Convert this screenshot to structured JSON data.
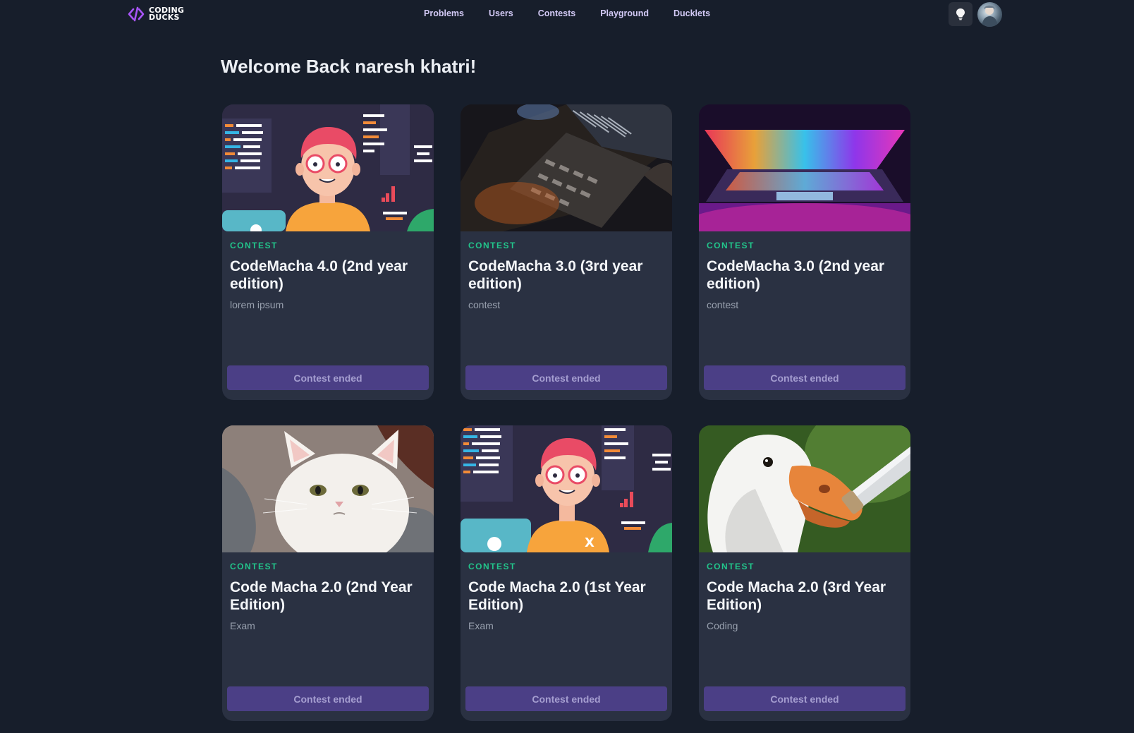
{
  "brand": {
    "line1": "CODING",
    "line2": "DUCKS",
    "accent": "#a855f7"
  },
  "nav": {
    "links": [
      "Problems",
      "Users",
      "Contests",
      "Playground",
      "Ducklets"
    ]
  },
  "icons": {
    "theme": "lightbulb-icon",
    "avatar": "user-avatar"
  },
  "welcome": "Welcome Back naresh khatri!",
  "cards": [
    {
      "tag": "CONTEST",
      "title": "CodeMacha 4.0 (2nd year edition)",
      "desc": "lorem ipsum",
      "button": "Contest ended",
      "image": "coder-illustration"
    },
    {
      "tag": "CONTEST",
      "title": "CodeMacha 3.0 (3rd year edition)",
      "desc": "contest",
      "button": "Contest ended",
      "image": "laptop-code-photo"
    },
    {
      "tag": "CONTEST",
      "title": "CodeMacha 3.0 (2nd year edition)",
      "desc": "contest",
      "button": "Contest ended",
      "image": "rainbow-laptop-photo"
    },
    {
      "tag": "CONTEST",
      "title": "Code Macha 2.0 (2nd Year Edition)",
      "desc": "Exam",
      "button": "Contest ended",
      "image": "cat-photo"
    },
    {
      "tag": "CONTEST",
      "title": "Code Macha 2.0 (1st Year Edition)",
      "desc": "Exam",
      "button": "Contest ended",
      "image": "coder-illustration"
    },
    {
      "tag": "CONTEST",
      "title": "Code Macha 2.0 (3rd Year Edition)",
      "desc": "Coding",
      "button": "Contest ended",
      "image": "goose-photo"
    }
  ],
  "colors": {
    "background": "#171e2b",
    "card": "#2a3142",
    "tag": "#22c58b",
    "button": "#4b3f86",
    "nav_link": "#d2c9f5"
  }
}
